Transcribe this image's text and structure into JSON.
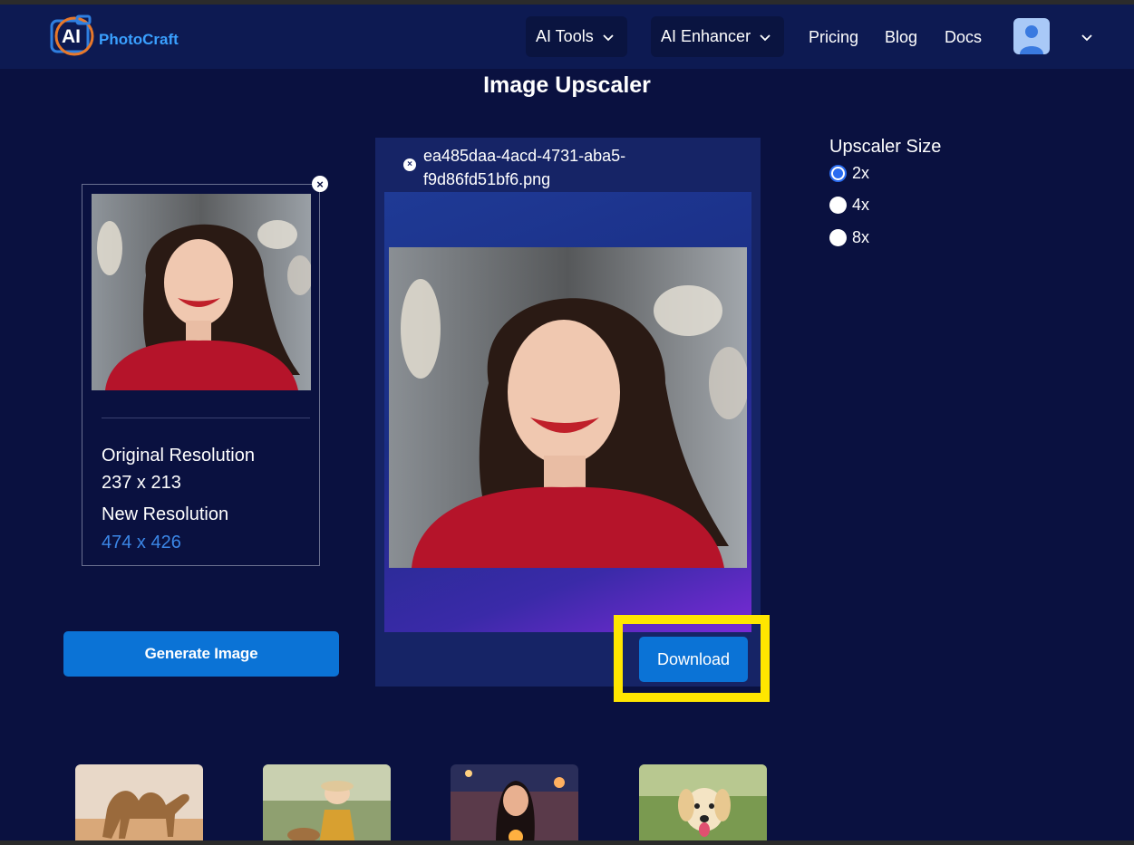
{
  "brand": {
    "logo_ai": "AI",
    "logo_name": "PhotoCraft"
  },
  "nav": {
    "ai_tools": "AI Tools",
    "ai_enhancer": "AI Enhancer",
    "pricing": "Pricing",
    "blog": "Blog",
    "docs": "Docs"
  },
  "page": {
    "title": "Image Upscaler"
  },
  "original": {
    "original_label": "Original Resolution",
    "original_value": "237 x 213",
    "new_label": "New Resolution",
    "new_value": "474 x 426",
    "remove_symbol": "×"
  },
  "actions": {
    "generate_label": "Generate Image",
    "download_label": "Download"
  },
  "result": {
    "file_name": "ea485daa-4acd-4731-aba5-f9d86fd51bf6.png",
    "remove_symbol": "×"
  },
  "upscaler": {
    "title": "Upscaler Size",
    "options": [
      {
        "label": "2x",
        "checked": true
      },
      {
        "label": "4x",
        "checked": false
      },
      {
        "label": "8x",
        "checked": false
      }
    ]
  },
  "samples": [
    "camel-photo",
    "child-photo",
    "woman-lights-photo",
    "puppy-photo"
  ],
  "colors": {
    "background": "#0a1140",
    "navbar": "#0d1a52",
    "accent_button": "#0b73d6",
    "new_resolution": "#3b86e6",
    "highlight": "#ffe600"
  }
}
